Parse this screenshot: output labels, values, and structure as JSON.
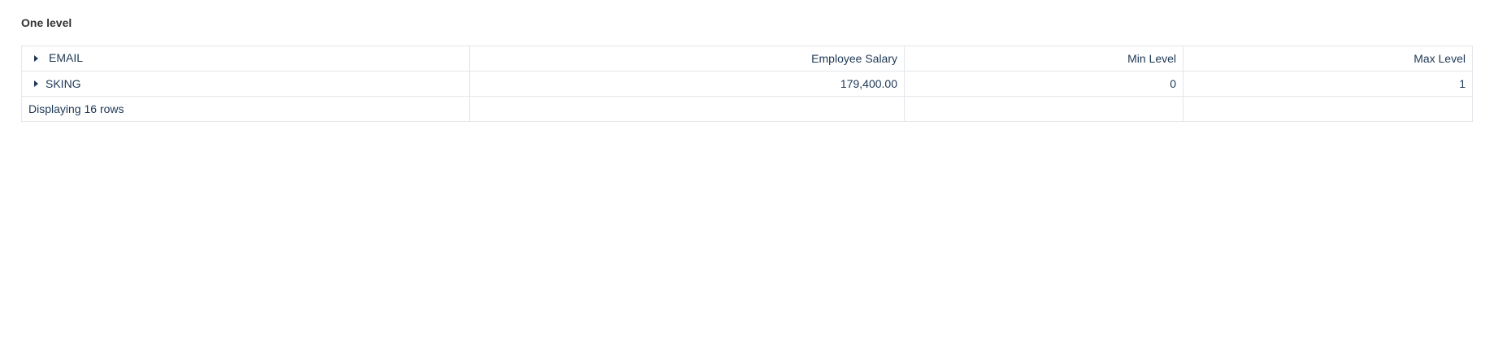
{
  "section": {
    "title": "One level"
  },
  "table": {
    "group_column_label": "EMAIL",
    "columns": [
      "Employee Salary",
      "Min Level",
      "Max Level"
    ],
    "rows": [
      {
        "group": "SKING",
        "employee_salary": "179,400.00",
        "min_level": "0",
        "max_level": "1"
      }
    ],
    "footer": "Displaying 16 rows"
  },
  "icons": {
    "expand": "caret-right-icon"
  },
  "colors": {
    "text": "#1d3856",
    "border": "#e3e6ea",
    "title": "#333333"
  }
}
